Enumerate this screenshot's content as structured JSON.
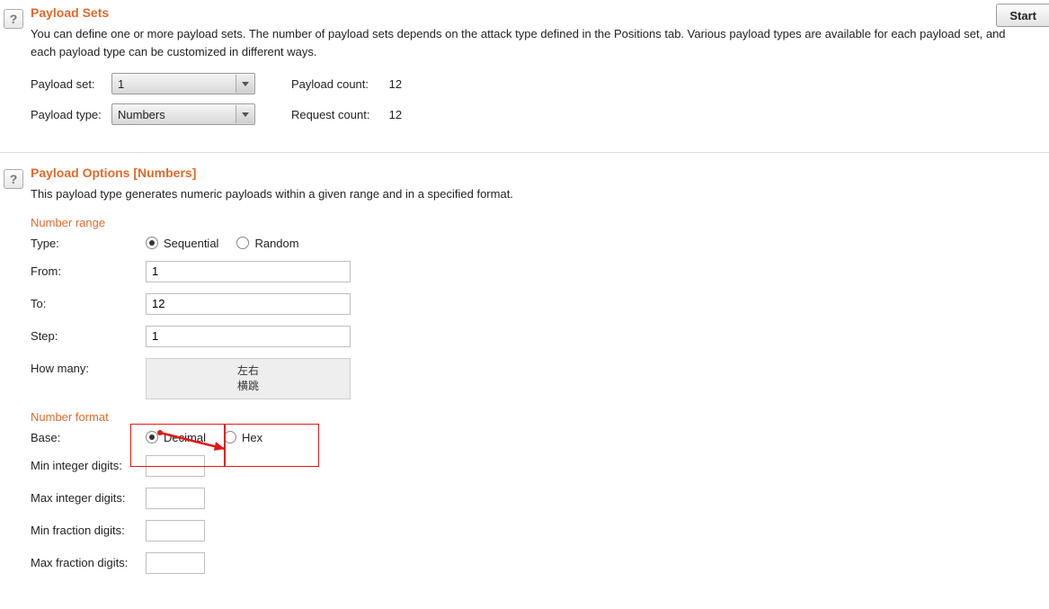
{
  "help_icon": "?",
  "start_button": "Start",
  "sets": {
    "title": "Payload Sets",
    "desc": "You can define one or more payload sets. The number of payload sets depends on the attack type defined in the Positions tab. Various payload types are available for each payload set, and each payload type can be customized in different ways.",
    "payload_set_label": "Payload set:",
    "payload_set_value": "1",
    "payload_type_label": "Payload type:",
    "payload_type_value": "Numbers",
    "payload_count_label": "Payload count:",
    "payload_count_value": "12",
    "request_count_label": "Request count:",
    "request_count_value": "12"
  },
  "options": {
    "title": "Payload Options [Numbers]",
    "desc": "This payload type generates numeric payloads within a given range and in a specified format.",
    "range": {
      "heading": "Number range",
      "type_label": "Type:",
      "type_sequential": "Sequential",
      "type_random": "Random",
      "from_label": "From:",
      "from_value": "1",
      "to_label": "To:",
      "to_value": "12",
      "step_label": "Step:",
      "step_value": "1",
      "howmany_label": "How many:",
      "howmany_text": "左右\n横跳"
    },
    "format": {
      "heading": "Number format",
      "base_label": "Base:",
      "base_decimal": "Decimal",
      "base_hex": "Hex",
      "min_int_label": "Min integer digits:",
      "min_int_value": "",
      "max_int_label": "Max integer digits:",
      "max_int_value": "",
      "min_frac_label": "Min fraction digits:",
      "min_frac_value": "",
      "max_frac_label": "Max fraction digits:",
      "max_frac_value": ""
    }
  }
}
